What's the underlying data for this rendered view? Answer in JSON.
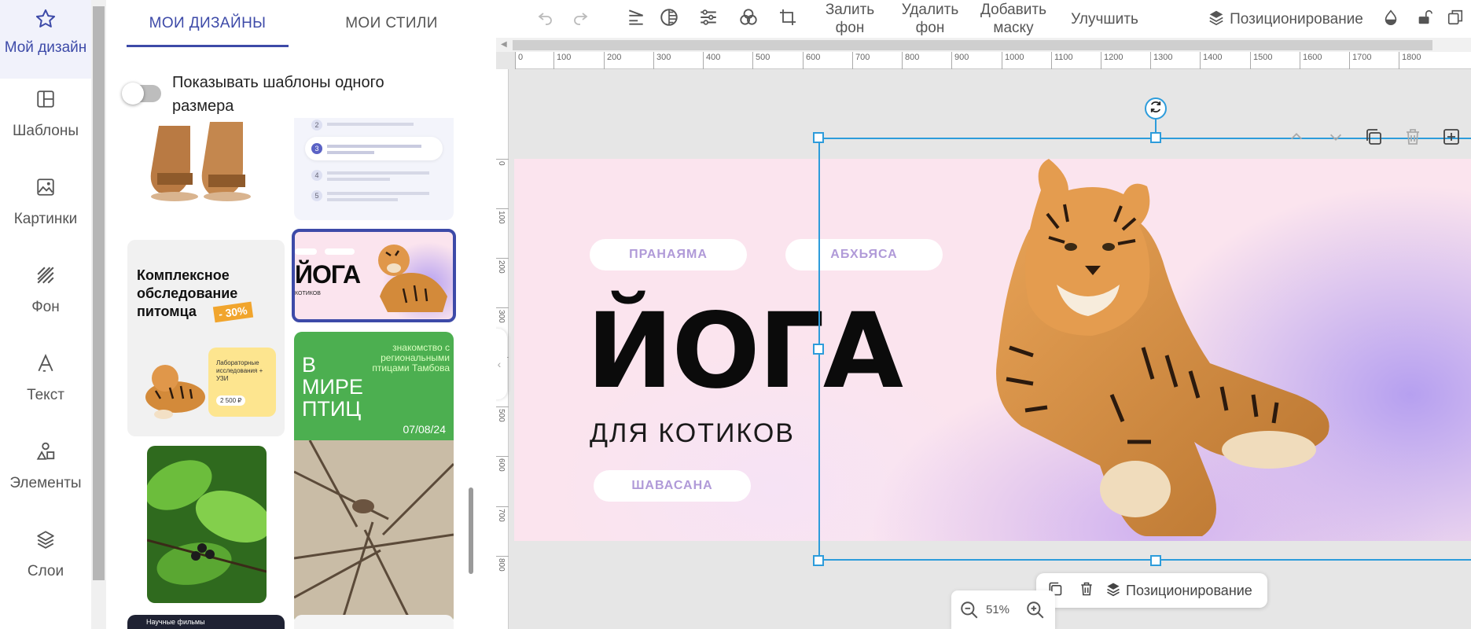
{
  "nav": {
    "items": [
      {
        "label": "Мой дизайн",
        "icon": "star-icon"
      },
      {
        "label": "Шаблоны",
        "icon": "template-icon"
      },
      {
        "label": "Картинки",
        "icon": "image-icon"
      },
      {
        "label": "Фон",
        "icon": "background-icon"
      },
      {
        "label": "Текст",
        "icon": "text-icon"
      },
      {
        "label": "Элементы",
        "icon": "shapes-icon"
      },
      {
        "label": "Слои",
        "icon": "layers-icon"
      }
    ]
  },
  "panel": {
    "tabs": [
      {
        "label": "МОИ ДИЗАЙНЫ"
      },
      {
        "label": "МОИ СТИЛИ"
      }
    ],
    "toggle_label": "Показывать шаблоны одного размера",
    "templates": {
      "list_rows": [
        "2",
        "3",
        "4",
        "5"
      ],
      "pet": {
        "title": "Комплексное обследование питомца",
        "badge": "- 30%",
        "note": "Лабораторные исследования + УЗИ",
        "price": "2 500 ₽"
      },
      "yoga": {
        "title": "ЙОГА",
        "sub": "КОТИКОВ"
      },
      "birds": {
        "title": "В МИРЕ ПТИЦ",
        "desc": "знакомство с региональными птицами Тамбова",
        "date": "07/08/24"
      },
      "films_caption": "Научные фильмы"
    }
  },
  "toolbar": {
    "fill_bg": "Залить фон",
    "remove_bg": "Удалить фон",
    "add_mask": "Добавить маску",
    "improve": "Улучшить",
    "positioning": "Позиционирование"
  },
  "ruler": {
    "h_ticks": [
      "0",
      "100",
      "200",
      "300",
      "400",
      "500",
      "600",
      "700",
      "800",
      "900",
      "1000",
      "1100",
      "1200",
      "1300",
      "1400",
      "1500",
      "1600",
      "1700",
      "1800"
    ],
    "v_ticks": [
      "0",
      "100",
      "200",
      "300",
      "400",
      "500",
      "600",
      "700",
      "800"
    ]
  },
  "design": {
    "pills": [
      "ПРАНАЯМА",
      "АБХЬЯСА",
      "ШАВАСАНА"
    ],
    "title": "ЙОГА",
    "subtitle": "ДЛЯ КОТИКОВ"
  },
  "context_bar": {
    "positioning": "Позиционирование"
  },
  "zoom": {
    "value": "51%"
  },
  "colors": {
    "accent": "#3d4aa8",
    "selection": "#2d9cdb",
    "pill_text": "#b09ad8",
    "bird_green": "#4caf50"
  }
}
